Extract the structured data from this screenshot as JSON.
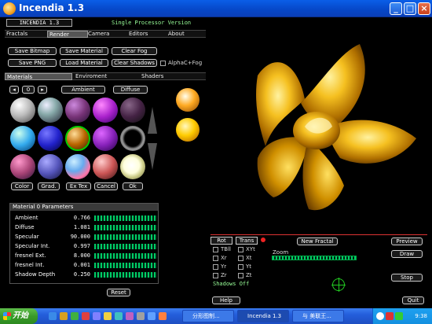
{
  "window": {
    "title": "Incendia 1.3"
  },
  "header": {
    "box_title": "INCENDIA 1.3",
    "version_text": "Single Processor Version"
  },
  "main_tabs": [
    "Fractals",
    "Render",
    "Camera",
    "Editors",
    "About"
  ],
  "main_tabs_active": "Render",
  "render_buttons": {
    "save_bitmap": "Save Bitmap",
    "save_material": "Save Material",
    "clear_fog": "Clear Fog",
    "save_png": "Save PNG",
    "load_material": "Load Material",
    "clear_shadows": "Clear Shadows",
    "alpha_fog": "AlphaC+Fog"
  },
  "sub_tabs": [
    "Materials",
    "Enviroment",
    "Shaders"
  ],
  "sub_tabs_active": "Materials",
  "material_index": "0",
  "ambient_label": "Ambient",
  "diffuse_label": "Diffuse",
  "palette_buttons": [
    "Color",
    "Grad.",
    "Ex Tex",
    "Cancel",
    "Ok"
  ],
  "params": {
    "title": "Material 0  Parameters",
    "rows": [
      {
        "name": "Ambient",
        "value": "0.766"
      },
      {
        "name": "Diffuse",
        "value": "1.081"
      },
      {
        "name": "Specular",
        "value": "90.000"
      },
      {
        "name": "Specular Int.",
        "value": "0.997"
      },
      {
        "name": "fresnel Ext.",
        "value": "8.000"
      },
      {
        "name": "fresnel Int.",
        "value": "0.001"
      },
      {
        "name": "Shadow Depth",
        "value": "0.250"
      }
    ],
    "reset": "Reset"
  },
  "controls": {
    "rot_tab": "Rot",
    "trans_tab": "Trans",
    "new_fractal": "New Fractal",
    "preview": "Preview",
    "draw": "Draw",
    "stop": "Stop",
    "help": "Help",
    "quit": "Quit",
    "zoom_label": "Zoom",
    "shadows_text": "Shadows Off",
    "rot_items": [
      "TBll",
      "Xr",
      "Yr",
      "Zr"
    ],
    "trans_items": [
      "XYt",
      "Xt",
      "Yt",
      "Zt"
    ]
  },
  "taskbar": {
    "start": "开始",
    "items": [
      "分形图制...",
      "Incendia 1.3",
      "与 美联王..."
    ],
    "active": "Incendia 1.3",
    "clock": "9:38"
  },
  "colors": {
    "title_blue": "#0647c7",
    "accent_green": "#00cc66",
    "gold": "#e0a800"
  }
}
